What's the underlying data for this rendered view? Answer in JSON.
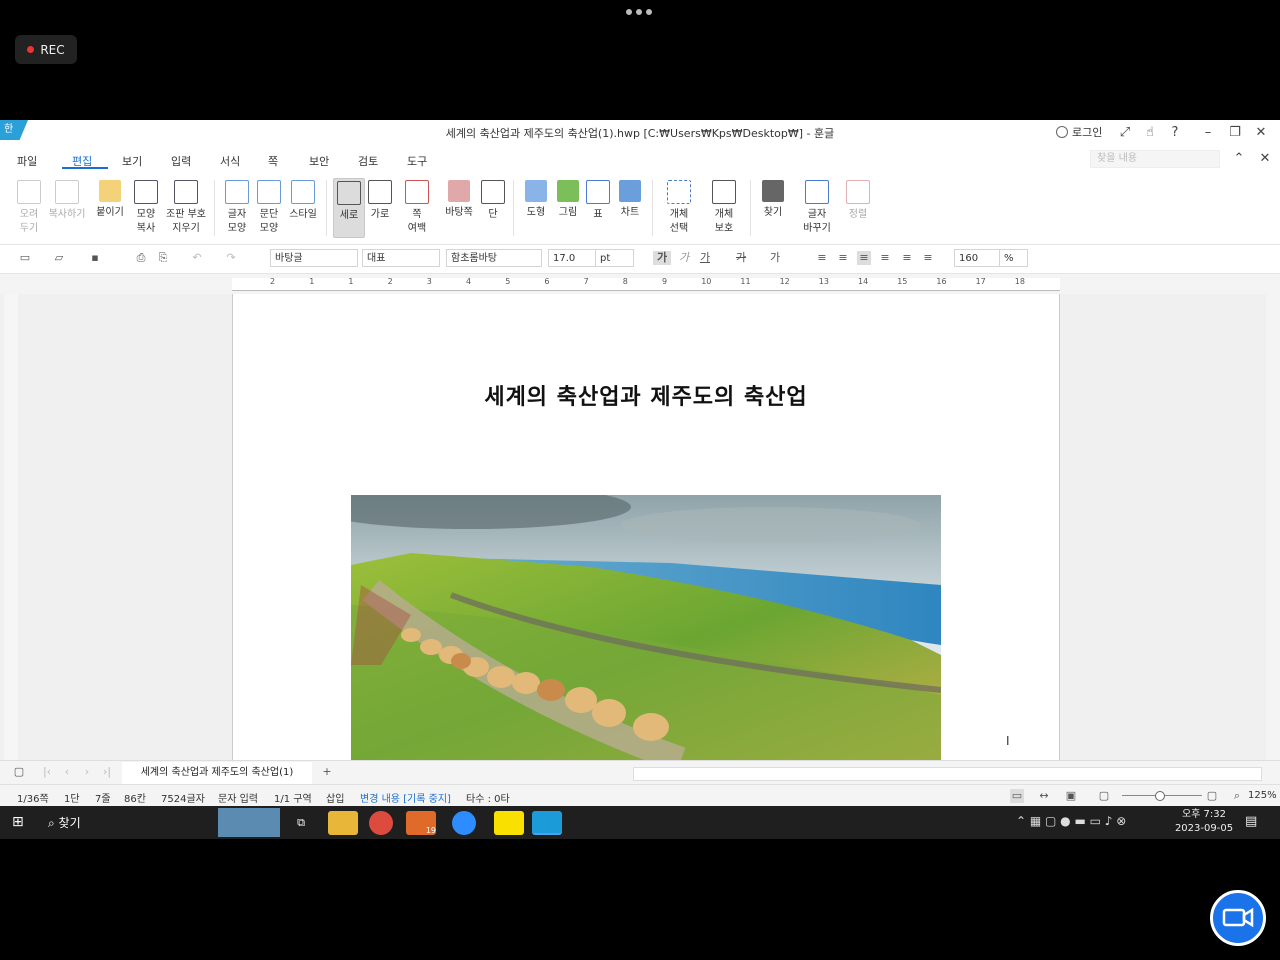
{
  "overlay": {
    "rec_label": "REC"
  },
  "window": {
    "title": "세계의 축산업과 제주도의 축산업(1).hwp [C:₩Users₩Kps₩Desktop₩] - 훈글",
    "logo": "한",
    "login_label": "로그인",
    "search_placeholder": "찾을 내용"
  },
  "menus": [
    "파일",
    "편집",
    "보기",
    "입력",
    "서식",
    "쪽",
    "보안",
    "검토",
    "도구"
  ],
  "ribbon": {
    "cut": "오려\n두기",
    "copy": "복사하기",
    "paste": "붙이기",
    "shape_copy": "모양\n복사",
    "clear_format": "조판 부호\n지우기",
    "char_shape": "글자\n모양",
    "para_shape": "문단\n모양",
    "style": "스타일",
    "portrait": "세로",
    "landscape": "가로",
    "margin": "쪽\n여백",
    "background": "바탕쪽",
    "column": "단",
    "shape": "도형",
    "picture": "그림",
    "table": "표",
    "chart": "차트",
    "select_obj": "개체\n선택",
    "protect_obj": "개체\n보호",
    "find": "찾기",
    "replace": "글자\n바꾸기",
    "proofread": "정렬"
  },
  "format": {
    "style": "바탕글",
    "lang": "대표",
    "font": "함초롬바탕",
    "size": "17.0",
    "unit": "pt",
    "bold": "가",
    "italic": "가",
    "underline": "가",
    "strike": "가",
    "color": "가",
    "spacing": "160",
    "spacing_unit": "%"
  },
  "ruler": [
    "2",
    "1",
    "1",
    "2",
    "3",
    "4",
    "5",
    "6",
    "7",
    "8",
    "9",
    "10",
    "11",
    "12",
    "13",
    "14",
    "15",
    "16",
    "17",
    "18"
  ],
  "document": {
    "title": "세계의 축산업과 제주도의 축산업"
  },
  "tab": {
    "name": "세계의 축산업과 제주도의 축산업(1)"
  },
  "status": {
    "page": "1/36쪽",
    "column": "1단",
    "line": "7줄",
    "col": "86칸",
    "chars": "7524글자",
    "input": "문자 입력",
    "section": "1/1 구역",
    "insert": "삽입",
    "track": "변경 내용 [기록 중지]",
    "typing": "타수 : 0타",
    "zoom": "125%"
  },
  "taskbar": {
    "search_label": "찾기",
    "time": "오후 7:32",
    "date": "2023-09-05",
    "badge": "19"
  }
}
